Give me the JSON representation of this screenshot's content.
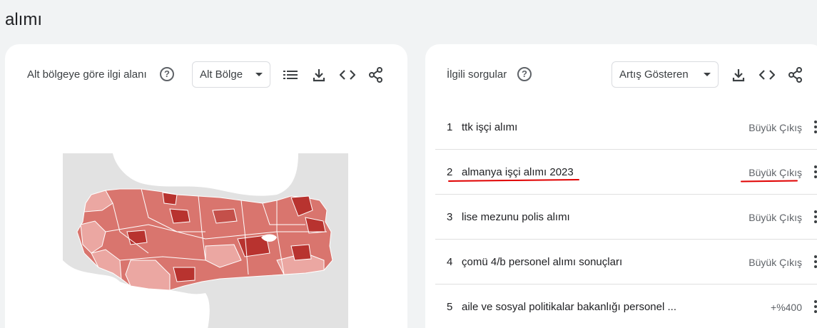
{
  "page": {
    "title": "alımı"
  },
  "left_card": {
    "title": "Alt bölgeye göre ilgi alanı",
    "help_symbol": "?",
    "dropdown_label": "Alt Bölge",
    "icons": [
      "list-icon",
      "download-icon",
      "embed-code-icon",
      "share-icon"
    ]
  },
  "right_card": {
    "title": "İlgili sorgular",
    "help_symbol": "?",
    "dropdown_label": "Artış Gösteren",
    "icons": [
      "download-icon",
      "embed-code-icon",
      "share-icon"
    ],
    "rows": [
      {
        "rank": "1",
        "query": "ttk işçi alımı",
        "value": "Büyük Çıkış"
      },
      {
        "rank": "2",
        "query": "almanya işçi alımı 2023",
        "value": "Büyük Çıkış"
      },
      {
        "rank": "3",
        "query": "lise mezunu polis alımı",
        "value": "Büyük Çıkış"
      },
      {
        "rank": "4",
        "query": "çomü 4/b personel alımı sonuçları",
        "value": "Büyük Çıkış"
      },
      {
        "rank": "5",
        "query": "aile ve sosyal politikalar bakanlığı personel ...",
        "value": "+%400"
      }
    ]
  },
  "colors": {
    "background": "#f1f3f4",
    "card": "#ffffff",
    "map_dark": "#b8332f",
    "map_mid": "#d9756e",
    "map_light": "#eba7a2",
    "annotation": "#e00000"
  }
}
